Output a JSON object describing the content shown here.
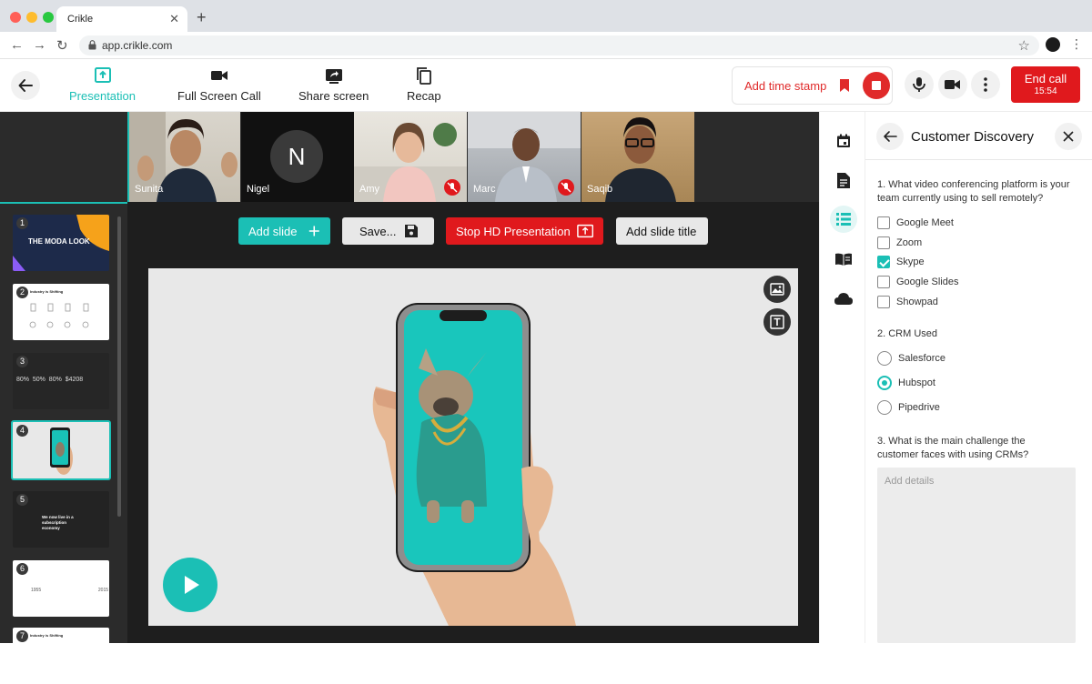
{
  "browser": {
    "tab_title": "Crikle",
    "url": "app.crikle.com"
  },
  "toolbar": {
    "tools": [
      {
        "label": "Presentation",
        "icon": "presentation-icon",
        "active": true
      },
      {
        "label": "Full Screen Call",
        "icon": "video-camera-icon",
        "active": false
      },
      {
        "label": "Share screen",
        "icon": "share-screen-icon",
        "active": false
      },
      {
        "label": "Recap",
        "icon": "copy-icon",
        "active": false
      }
    ],
    "add_time_stamp": "Add time stamp",
    "end_call_label": "End call",
    "end_call_time": "15:54"
  },
  "participants": [
    {
      "name": "Sunita",
      "muted": false
    },
    {
      "name": "Nigel",
      "initial": "N",
      "muted": false
    },
    {
      "name": "Amy",
      "muted": true
    },
    {
      "name": "Marc",
      "muted": true
    },
    {
      "name": "Saqib",
      "muted": false
    }
  ],
  "slides": {
    "items": [
      {
        "number": "1",
        "text": "THE MODA LOOK"
      },
      {
        "number": "2",
        "text": "Industry is Shifting"
      },
      {
        "number": "3",
        "text": "80%  50%  80%  $4208"
      },
      {
        "number": "4",
        "text": ""
      },
      {
        "number": "5",
        "text": "We now live in a subscription economy"
      },
      {
        "number": "6",
        "text": "1955  2015"
      },
      {
        "number": "7",
        "text": "Industry is Shifting"
      }
    ],
    "selected": "4"
  },
  "slide_tools": {
    "add_slide": "Add slide",
    "save": "Save...",
    "stop_hd": "Stop HD Presentation",
    "add_title": "Add slide title"
  },
  "survey": {
    "title": "Customer Discovery",
    "q1": "1. What video conferencing platform is your team currently using to sell remotely?",
    "q1_options": [
      {
        "label": "Google Meet",
        "checked": false
      },
      {
        "label": "Zoom",
        "checked": false
      },
      {
        "label": "Skype",
        "checked": true
      },
      {
        "label": "Google Slides",
        "checked": false
      },
      {
        "label": "Showpad",
        "checked": false
      }
    ],
    "q2": "2. CRM Used",
    "q2_options": [
      {
        "label": "Salesforce",
        "checked": false
      },
      {
        "label": "Hubspot",
        "checked": true
      },
      {
        "label": "Pipedrive",
        "checked": false
      }
    ],
    "q3": "3. What is the main challenge the customer faces with using CRMs?",
    "q3_placeholder": "Add details"
  },
  "colors": {
    "accent": "#1bbfb5",
    "danger": "#e0191d"
  }
}
